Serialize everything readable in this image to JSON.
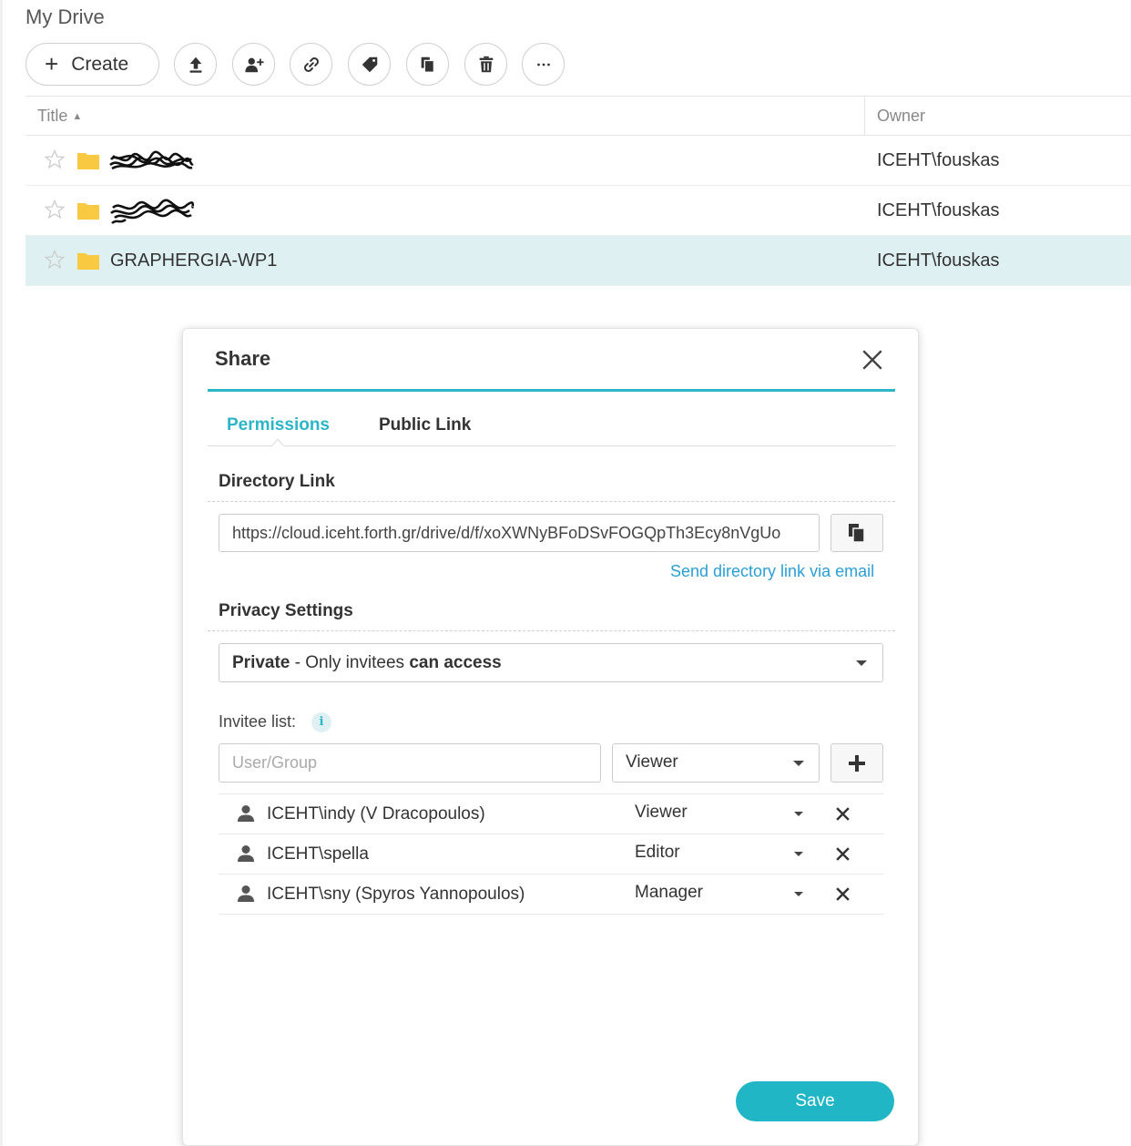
{
  "page": {
    "title": "My Drive"
  },
  "toolbar": {
    "create_label": "Create",
    "icons": [
      "upload-icon",
      "add-user-icon",
      "link-icon",
      "tag-icon",
      "copy-icon",
      "trash-icon",
      "more-icon"
    ]
  },
  "table": {
    "columns": {
      "title": "Title",
      "owner": "Owner"
    },
    "rows": [
      {
        "name": "",
        "owner": "ICEHT\\fouskas",
        "redacted": true
      },
      {
        "name": "",
        "owner": "ICEHT\\fouskas",
        "redacted": true
      },
      {
        "name": "GRAPHERGIA-WP1",
        "owner": "ICEHT\\fouskas",
        "selected": true
      }
    ]
  },
  "dialog": {
    "title": "Share",
    "tabs": {
      "permissions": "Permissions",
      "public_link": "Public Link"
    },
    "directory_link": {
      "label": "Directory Link",
      "url": "https://cloud.iceht.forth.gr/drive/d/f/xoXWNyBFoDSvFOGQpTh3Ecy8nVgUo",
      "email_link": "Send directory link via email"
    },
    "privacy": {
      "label": "Privacy Settings",
      "value_bold": "Private",
      "value_rest": " - Only invitees ",
      "value_tail": "can access"
    },
    "invitees": {
      "label": "Invitee list:",
      "input_placeholder": "User/Group",
      "role_default": "Viewer",
      "list": [
        {
          "name": "ICEHT\\indy (V Dracopoulos)",
          "role": "Viewer"
        },
        {
          "name": "ICEHT\\spella",
          "role": "Editor"
        },
        {
          "name": "ICEHT\\sny (Spyros Yannopoulos)",
          "role": "Manager"
        }
      ]
    },
    "save_label": "Save"
  },
  "colors": {
    "accent": "#21b6c6",
    "selected_row": "#dff0f3",
    "folder": "#f9c941",
    "link": "#2a9fd6"
  }
}
